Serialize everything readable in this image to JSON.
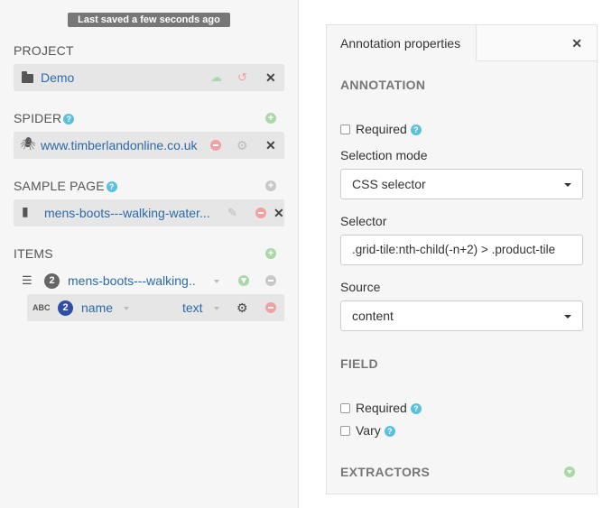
{
  "status": {
    "saved_label": "Last saved a few seconds ago"
  },
  "project": {
    "title": "PROJECT",
    "name": "Demo"
  },
  "spider": {
    "title": "SPIDER",
    "name": "www.timberlandonline.co.uk"
  },
  "sample_page": {
    "title": "SAMPLE PAGE",
    "name": "mens-boots---walking-water..."
  },
  "items": {
    "title": "ITEMS",
    "item": {
      "count": "2",
      "name": "mens-boots---walking.."
    },
    "field": {
      "type_icon": "ABC",
      "count": "2",
      "name": "name",
      "type": "text"
    }
  },
  "panel": {
    "tab_label": "Annotation properties",
    "annotation_heading": "ANNOTATION",
    "required_label": "Required",
    "selection_mode_label": "Selection mode",
    "selection_mode_value": "CSS selector",
    "selector_label": "Selector",
    "selector_value": ".grid-tile:nth-child(-n+2) > .product-tile",
    "source_label": "Source",
    "source_value": "content",
    "field_heading": "FIELD",
    "field_required_label": "Required",
    "vary_label": "Vary",
    "extractors_heading": "EXTRACTORS"
  },
  "colors": {
    "link": "#2b6aa8",
    "help": "#5bc0de",
    "add_green": "#aad8a6",
    "delete_red": "#f2a0a0",
    "field_badge": "#2f4da3",
    "item_badge": "#666666"
  }
}
